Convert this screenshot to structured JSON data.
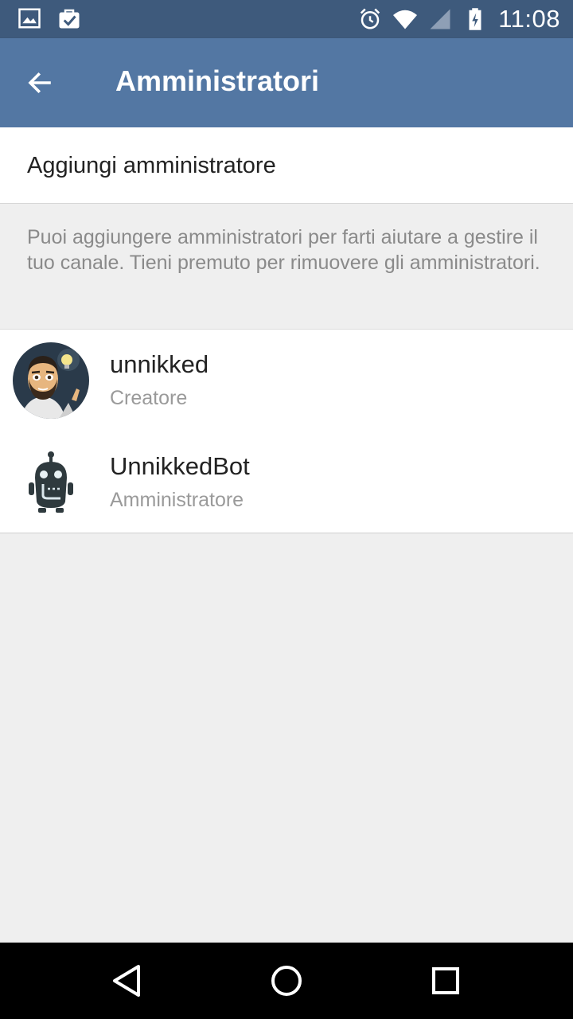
{
  "status_bar": {
    "time": "11:08",
    "left_icons": [
      "image-notification-icon",
      "shopping-bag-notification-icon"
    ],
    "right_icons": [
      "alarm-icon",
      "wifi-icon",
      "cell-signal-icon",
      "battery-charging-icon"
    ]
  },
  "app_bar": {
    "title": "Amministratori",
    "back_icon": "arrow-left-icon"
  },
  "add_admin": {
    "label": "Aggiungi amministratore"
  },
  "info_text": "Puoi aggiungere amministratori per farti aiutare a gestire il tuo canale. Tieni premuto per rimuovere gli amministratori.",
  "admins": [
    {
      "name": "unnikked",
      "role": "Creatore",
      "avatar": "user-avatar-photo"
    },
    {
      "name": "UnnikkedBot",
      "role": "Amministratore",
      "avatar": "robot-avatar-icon"
    }
  ],
  "nav_bar": {
    "back": "triangle-back-icon",
    "home": "circle-home-icon",
    "recents": "square-recents-icon"
  },
  "colors": {
    "status_bar": "#3e5a7c",
    "app_bar": "#5377a3",
    "background": "#efefef",
    "card": "#ffffff"
  }
}
